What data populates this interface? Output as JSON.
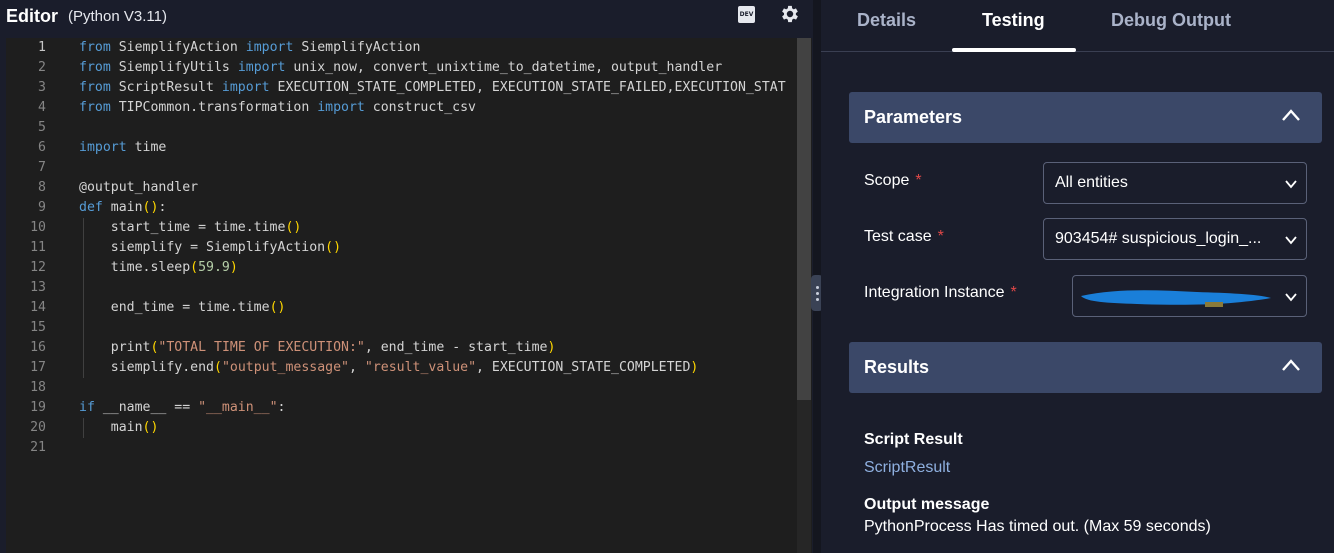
{
  "editor": {
    "title": "Editor",
    "version": "(Python V3.11)",
    "dev_badge": "DEV",
    "active_line": 1,
    "lines": [
      "from SiemplifyAction import SiemplifyAction",
      "from SiemplifyUtils import unix_now, convert_unixtime_to_datetime, output_handler",
      "from ScriptResult import EXECUTION_STATE_COMPLETED, EXECUTION_STATE_FAILED,EXECUTION_STAT",
      "from TIPCommon.transformation import construct_csv",
      "",
      "import time",
      "",
      "@output_handler",
      "def main():",
      "    start_time = time.time()",
      "    siemplify = SiemplifyAction()",
      "    time.sleep(59.9)",
      "",
      "    end_time = time.time()",
      "",
      "    print(\"TOTAL TIME OF EXECUTION:\", end_time - start_time)",
      "    siemplify.end(\"output_message\", \"result_value\", EXECUTION_STATE_COMPLETED)",
      "",
      "if __name__ == \"__main__\":",
      "    main()",
      ""
    ]
  },
  "tabs": [
    {
      "label": "Details",
      "active": false
    },
    {
      "label": "Testing",
      "active": true
    },
    {
      "label": "Debug Output",
      "active": false
    }
  ],
  "parameters": {
    "title": "Parameters",
    "fields": [
      {
        "label": "Scope",
        "required": "*",
        "value": "All entities"
      },
      {
        "label": "Test case",
        "required": "*",
        "value": "903454# suspicious_login_..."
      },
      {
        "label": "Integration Instance",
        "required": "*",
        "value": ""
      }
    ]
  },
  "results": {
    "title": "Results",
    "script_result_label": "Script Result",
    "script_result_value": "ScriptResult",
    "output_message_label": "Output message",
    "output_message_value": "PythonProcess Has timed out. (Max 59 seconds)"
  },
  "colors": {
    "keyword": "#569cd6",
    "string": "#ce9178",
    "number": "#b5cea8",
    "section_header": "#3b4868",
    "required": "#e04848",
    "redaction": "#1a7fd9"
  }
}
